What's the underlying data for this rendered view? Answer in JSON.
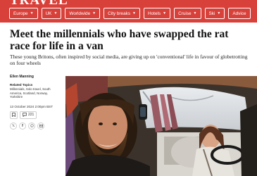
{
  "header": {
    "section_title": "TRAVEL"
  },
  "nav": {
    "items": [
      {
        "label": "Europe",
        "chevron": true
      },
      {
        "label": "UK",
        "chevron": true
      },
      {
        "label": "Worldwide",
        "chevron": true
      },
      {
        "label": "City breaks",
        "chevron": true
      },
      {
        "label": "Hotels",
        "chevron": true
      },
      {
        "label": "Cruise",
        "chevron": true
      },
      {
        "label": "Ski",
        "chevron": true
      },
      {
        "label": "Advice",
        "chevron": false
      }
    ],
    "chevron_glyph": "▼"
  },
  "article": {
    "headline": "Meet the millennials who have swapped the rat race for life in a van",
    "standfirst": "These young Britons, often inspired by social media, are giving up on 'conventional' life in favour of globetrotting on four wheels",
    "author": "Ellen Manning",
    "related_heading": "Related Topics",
    "related_topics": "Millennials, Solo travel, South America, Scotland, Norway, Yorkshire",
    "date": "13 October 2024 2:00pm BST",
    "comment_count": "221"
  },
  "icons": {
    "bookmark": "bookmark-icon",
    "comment": "comment-icon",
    "share_x": "x-icon",
    "share_facebook": "facebook-icon",
    "share_whatsapp": "whatsapp-icon",
    "share_email": "email-icon"
  },
  "colors": {
    "brand": "#d8403a"
  }
}
